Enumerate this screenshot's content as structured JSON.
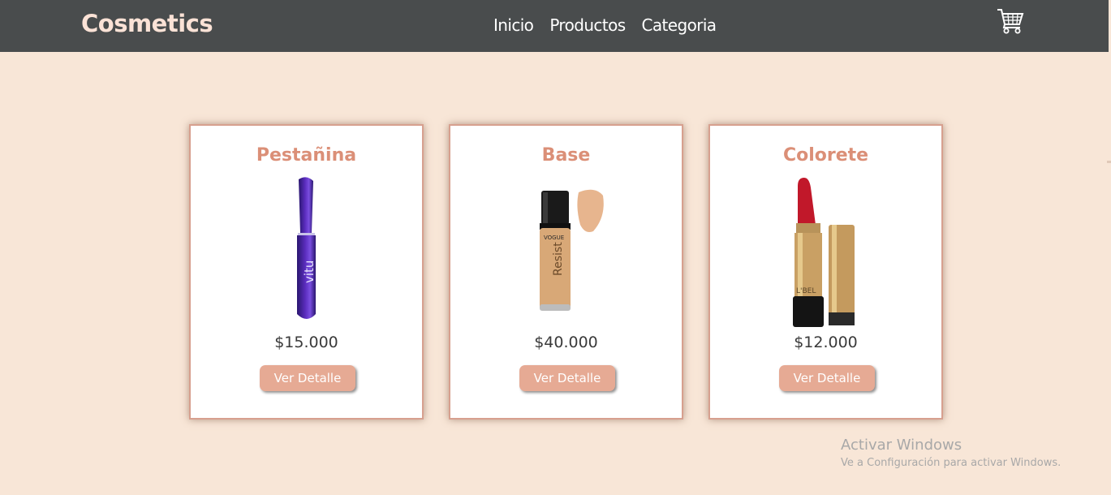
{
  "header": {
    "brand": "Cosmetics",
    "nav": [
      "Inicio",
      "Productos",
      "Categoria"
    ],
    "cart_icon": "shopping-cart-icon"
  },
  "products": [
    {
      "title": "Pestañina",
      "price": "$15.000",
      "button": "Ver Detalle",
      "image": "mascara-image"
    },
    {
      "title": "Base",
      "price": "$40.000",
      "button": "Ver Detalle",
      "image": "foundation-image",
      "image_text": "VOGUE"
    },
    {
      "title": "Colorete",
      "price": "$12.000",
      "button": "Ver Detalle",
      "image": "lipstick-image",
      "image_text": "L'BEL"
    }
  ],
  "watermark": {
    "title": "Activar Windows",
    "subtitle": "Ve a Configuración para activar Windows."
  },
  "colors": {
    "page_bg": "#f8e6d7",
    "navbar_bg": "#494c4d",
    "brand": "#fbe2d6",
    "card_title": "#db8f77",
    "button_bg": "#e6aa94",
    "card_border": "#d7a08f"
  }
}
